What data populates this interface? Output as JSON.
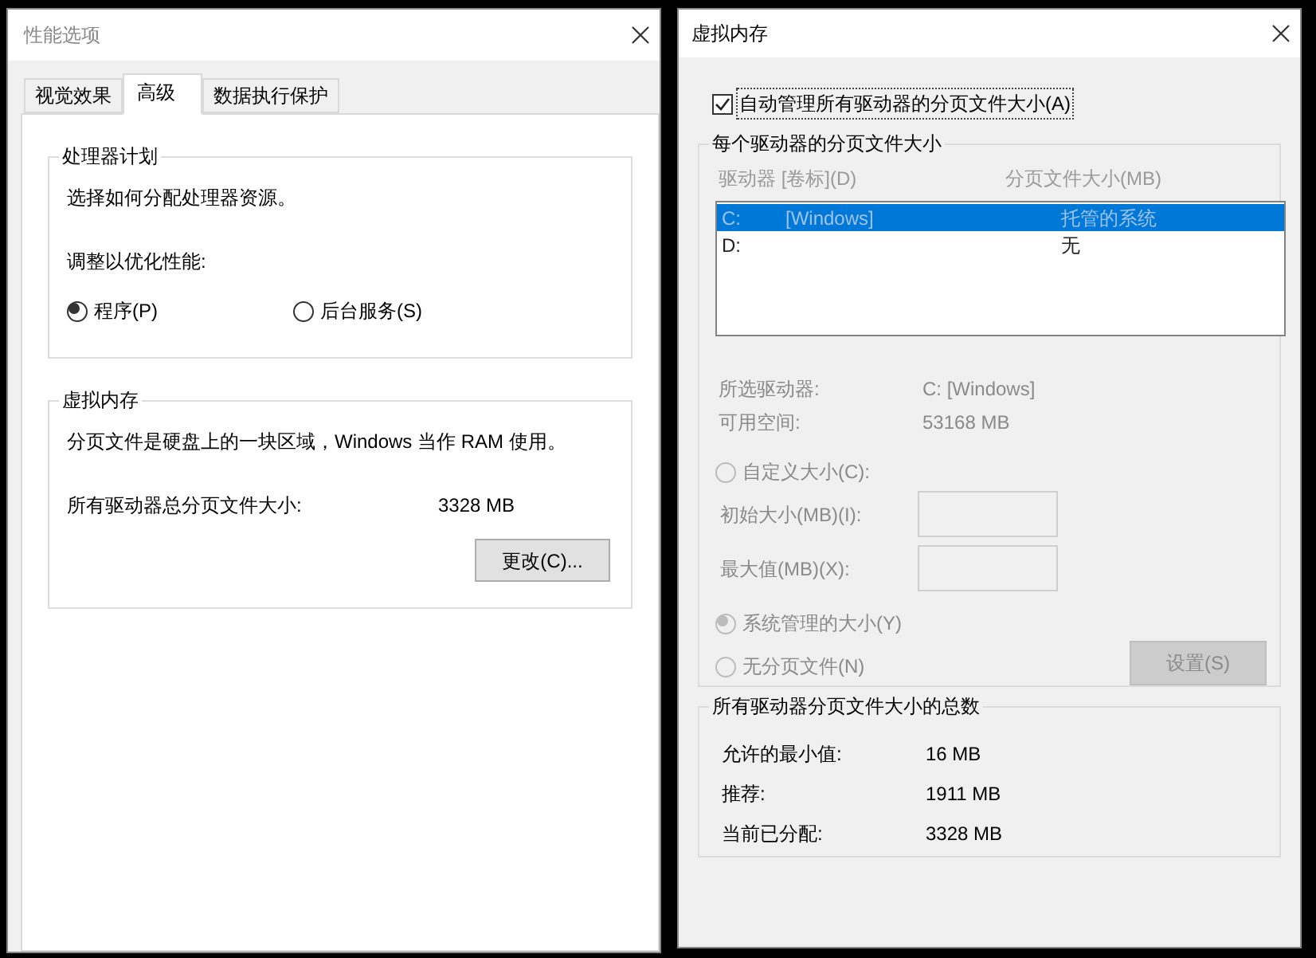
{
  "performance_window": {
    "title": "性能选项",
    "tabs": [
      {
        "label": "视觉效果",
        "selected": false
      },
      {
        "label": "高级",
        "selected": true
      },
      {
        "label": "数据执行保护",
        "selected": false
      }
    ],
    "processor_group": {
      "title": "处理器计划",
      "description": "选择如何分配处理器资源。",
      "prompt": "调整以优化性能:",
      "options": [
        {
          "label": "程序(P)",
          "selected": true
        },
        {
          "label": "后台服务(S)",
          "selected": false
        }
      ]
    },
    "virtual_memory_group": {
      "title": "虚拟内存",
      "description": "分页文件是硬盘上的一块区域，Windows 当作 RAM 使用。",
      "total_label": "所有驱动器总分页文件大小:",
      "total_value": "3328 MB",
      "button": "更改(C)..."
    }
  },
  "virtual_memory_window": {
    "title": "虚拟内存",
    "auto_manage": {
      "label": "自动管理所有驱动器的分页文件大小(A)",
      "checked": true
    },
    "per_drive_group": {
      "title": "每个驱动器的分页文件大小",
      "columns": [
        "驱动器 [卷标](D)",
        "分页文件大小(MB)"
      ],
      "rows": [
        {
          "drive": "C:",
          "volume": "[Windows]",
          "size": "托管的系统",
          "selected": true
        },
        {
          "drive": "D:",
          "size": "无",
          "selected": false
        }
      ],
      "selected_drive_label": "所选驱动器:",
      "selected_drive_value": "C: [Windows]",
      "free_space_label": "可用空间:",
      "free_space_value": "53168 MB",
      "custom_option": {
        "label": "自定义大小(C):",
        "selected": false
      },
      "initial_size_label": "初始大小(MB)(I):",
      "max_size_label": "最大值(MB)(X):",
      "system_option": {
        "label": "系统管理的大小(Y)",
        "selected": true
      },
      "none_option": {
        "label": "无分页文件(N)",
        "selected": false
      },
      "set_button": {
        "label": "设置(S)",
        "disabled": true
      }
    },
    "totals_group": {
      "title": "所有驱动器分页文件大小的总数",
      "rows": [
        {
          "label": "允许的最小值:",
          "value": "16 MB"
        },
        {
          "label": "推荐:",
          "value": "1911 MB"
        },
        {
          "label": "当前已分配:",
          "value": "3328 MB"
        }
      ]
    }
  }
}
